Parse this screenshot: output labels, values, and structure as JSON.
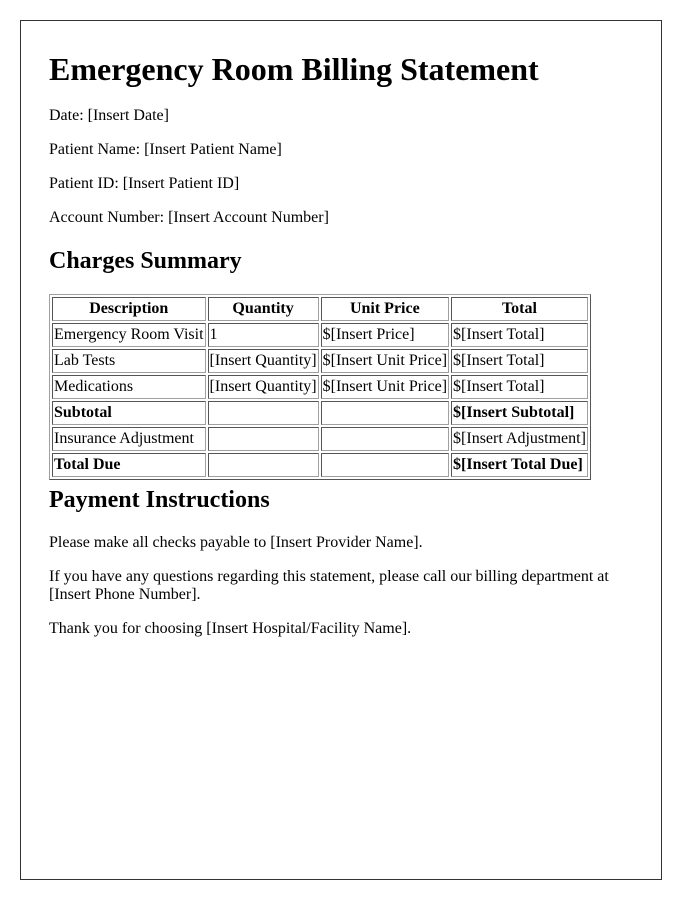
{
  "document": {
    "title": "Emergency Room Billing Statement",
    "info": {
      "date": "Date: [Insert Date]",
      "patient_name": "Patient Name: [Insert Patient Name]",
      "patient_id": "Patient ID: [Insert Patient ID]",
      "account_number": "Account Number: [Insert Account Number]"
    },
    "charges": {
      "heading": "Charges Summary",
      "columns": [
        "Description",
        "Quantity",
        "Unit Price",
        "Total"
      ],
      "rows": [
        [
          "Emergency Room Visit",
          "1",
          "$[Insert Price]",
          "$[Insert Total]"
        ],
        [
          "Lab Tests",
          "[Insert Quantity]",
          "$[Insert Unit Price]",
          "$[Insert Total]"
        ],
        [
          "Medications",
          "[Insert Quantity]",
          "$[Insert Unit Price]",
          "$[Insert Total]"
        ],
        [
          "Subtotal",
          "",
          "",
          "$[Insert Subtotal]"
        ],
        [
          "Insurance Adjustment",
          "",
          "",
          "$[Insert Adjustment]"
        ],
        [
          "Total Due",
          "",
          "",
          "$[Insert Total Due]"
        ]
      ]
    },
    "payment": {
      "heading": "Payment Instructions",
      "paragraphs": [
        "Please make all checks payable to [Insert Provider Name].",
        "If you have any questions regarding this statement, please call our billing department at [Insert Phone Number].",
        "Thank you for choosing [Insert Hospital/Facility Name]."
      ]
    }
  }
}
